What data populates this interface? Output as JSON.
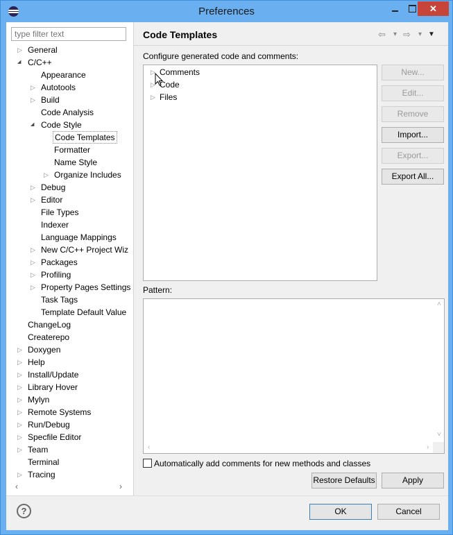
{
  "window": {
    "title": "Preferences",
    "minimize": "–",
    "maximize": "□",
    "close": "✕"
  },
  "filter": {
    "placeholder": "type filter text"
  },
  "tree": {
    "items": [
      {
        "label": "General",
        "expandable": true,
        "expanded": false,
        "level": 0
      },
      {
        "label": "C/C++",
        "expandable": true,
        "expanded": true,
        "level": 0
      },
      {
        "label": "Appearance",
        "expandable": false,
        "level": 1
      },
      {
        "label": "Autotools",
        "expandable": true,
        "expanded": false,
        "level": 1
      },
      {
        "label": "Build",
        "expandable": true,
        "expanded": false,
        "level": 1
      },
      {
        "label": "Code Analysis",
        "expandable": false,
        "level": 1
      },
      {
        "label": "Code Style",
        "expandable": true,
        "expanded": true,
        "level": 1
      },
      {
        "label": "Code Templates",
        "expandable": false,
        "level": 2,
        "selected": true
      },
      {
        "label": "Formatter",
        "expandable": false,
        "level": 2
      },
      {
        "label": "Name Style",
        "expandable": false,
        "level": 2
      },
      {
        "label": "Organize Includes",
        "expandable": true,
        "expanded": false,
        "level": 2
      },
      {
        "label": "Debug",
        "expandable": true,
        "expanded": false,
        "level": 1
      },
      {
        "label": "Editor",
        "expandable": true,
        "expanded": false,
        "level": 1
      },
      {
        "label": "File Types",
        "expandable": false,
        "level": 1
      },
      {
        "label": "Indexer",
        "expandable": false,
        "level": 1
      },
      {
        "label": "Language Mappings",
        "expandable": false,
        "level": 1
      },
      {
        "label": "New C/C++ Project Wiz",
        "expandable": true,
        "expanded": false,
        "level": 1
      },
      {
        "label": "Packages",
        "expandable": true,
        "expanded": false,
        "level": 1
      },
      {
        "label": "Profiling",
        "expandable": true,
        "expanded": false,
        "level": 1
      },
      {
        "label": "Property Pages Settings",
        "expandable": true,
        "expanded": false,
        "level": 1
      },
      {
        "label": "Task Tags",
        "expandable": false,
        "level": 1
      },
      {
        "label": "Template Default Value",
        "expandable": false,
        "level": 1
      },
      {
        "label": "ChangeLog",
        "expandable": false,
        "level": 0
      },
      {
        "label": "Createrepo",
        "expandable": false,
        "level": 0
      },
      {
        "label": "Doxygen",
        "expandable": true,
        "expanded": false,
        "level": 0
      },
      {
        "label": "Help",
        "expandable": true,
        "expanded": false,
        "level": 0
      },
      {
        "label": "Install/Update",
        "expandable": true,
        "expanded": false,
        "level": 0
      },
      {
        "label": "Library Hover",
        "expandable": true,
        "expanded": false,
        "level": 0
      },
      {
        "label": "Mylyn",
        "expandable": true,
        "expanded": false,
        "level": 0
      },
      {
        "label": "Remote Systems",
        "expandable": true,
        "expanded": false,
        "level": 0
      },
      {
        "label": "Run/Debug",
        "expandable": true,
        "expanded": false,
        "level": 0
      },
      {
        "label": "Specfile Editor",
        "expandable": true,
        "expanded": false,
        "level": 0
      },
      {
        "label": "Team",
        "expandable": true,
        "expanded": false,
        "level": 0
      },
      {
        "label": "Terminal",
        "expandable": false,
        "level": 0
      },
      {
        "label": "Tracing",
        "expandable": true,
        "expanded": false,
        "level": 0
      }
    ],
    "scroll_left": "‹",
    "scroll_right": "›"
  },
  "page": {
    "title": "Code Templates",
    "nav_back": "⇦",
    "nav_forward": "⇨",
    "nav_dropdown": "▾",
    "menu": "▼",
    "description": "Configure generated code and comments:",
    "templates": [
      {
        "label": "Comments"
      },
      {
        "label": "Code"
      },
      {
        "label": "Files"
      }
    ],
    "buttons": {
      "new": "New...",
      "edit": "Edit...",
      "remove": "Remove",
      "import": "Import...",
      "export": "Export...",
      "export_all": "Export All..."
    },
    "pattern_label": "Pattern:",
    "auto_comments_label": "Automatically add comments for new methods and classes",
    "restore_defaults": "Restore Defaults",
    "apply": "Apply"
  },
  "footer": {
    "help": "?",
    "ok": "OK",
    "cancel": "Cancel"
  }
}
